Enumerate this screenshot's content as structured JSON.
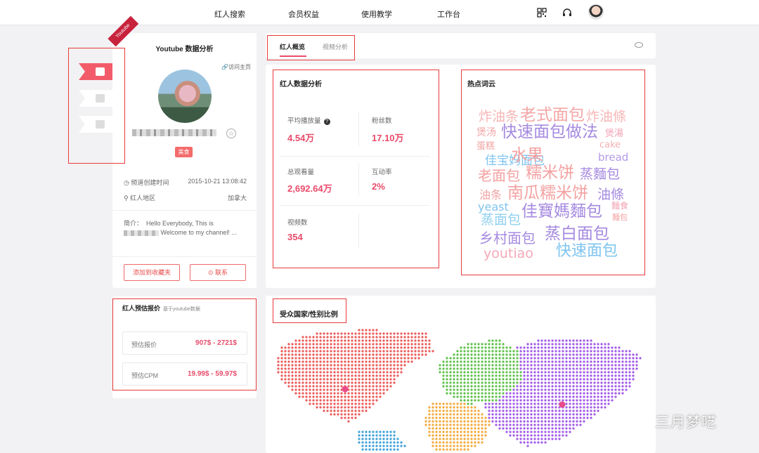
{
  "nav": {
    "items": [
      "红人搜索",
      "会员权益",
      "使用教学",
      "工作台"
    ],
    "icons": [
      "qrcode-icon",
      "headset-icon"
    ]
  },
  "profile": {
    "platform_ribbon": "Youtube",
    "title": "Youtube 数据分析",
    "visit_link": "访问主页",
    "tag": "美食",
    "created_label": "频道创建时间",
    "created_value": "2015-10-21 13:08:42",
    "region_label": "红人地区",
    "region_value": "加拿大",
    "bio_label": "简介：",
    "bio_line1": "Hello Everybody, This is",
    "bio_line2": "Welcome to my channel! ...",
    "fav_button": "添加到收藏夹",
    "contact_button": "联系"
  },
  "quote": {
    "title": "红人预估报价",
    "subtitle": "基于youtube数据",
    "rows": [
      {
        "label": "预估报价",
        "value": "907$ - 2721$"
      },
      {
        "label": "预估CPM",
        "value": "19.99$ - 59.97$"
      }
    ]
  },
  "tabs": {
    "overview": "红人概览",
    "video": "视频分析"
  },
  "stats": {
    "title": "红人数据分析",
    "items": [
      {
        "label": "平均播放量",
        "value": "4.54万"
      },
      {
        "label": "粉丝数",
        "value": "17.10万"
      },
      {
        "label": "总观看量",
        "value": "2,692.64万"
      },
      {
        "label": "互动率",
        "value": "2%"
      },
      {
        "label": "视频数",
        "value": "354"
      }
    ]
  },
  "cloud": {
    "title": "热点词云",
    "words": [
      "炸油条",
      "老式面包",
      "炸油條",
      "煲汤",
      "快速面包做法",
      "煲湯",
      "蛋糕",
      "cake",
      "佳宝妈面包",
      "水果",
      "bread",
      "老面包",
      "糯米饼",
      "蒸麵包",
      "油条",
      "南瓜糯米饼",
      "油條",
      "yeast",
      "麵食",
      "佳寶媽麵包",
      "蒸面包",
      "麵包",
      "乡村面包",
      "蒸白面包",
      "youtiao",
      "快速面包"
    ]
  },
  "map": {
    "title": "受众国家/性别比例",
    "colors": {
      "north_america": "#ec5a5a",
      "europe": "#5ec14a",
      "asia": "#a15ae8",
      "africa": "#f4a93a",
      "south_america": "#3fa0d9",
      "marker": "#e94b8a"
    }
  },
  "watermark": "三月梦呓"
}
